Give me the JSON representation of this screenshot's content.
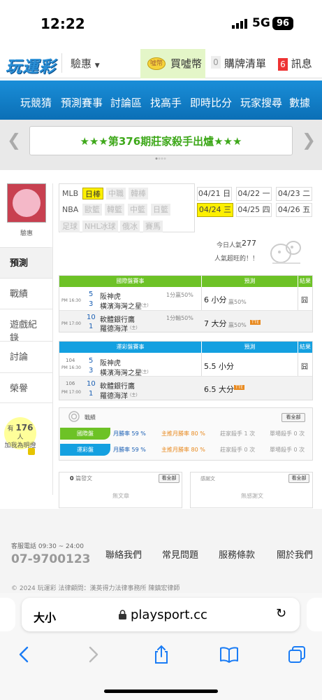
{
  "status": {
    "time": "12:22",
    "network": "5G",
    "battery": "96"
  },
  "header": {
    "logo": "玩運彩",
    "discount": "驗惠",
    "buy_coin": "買噓幣",
    "coin_icon_text": "噓幣",
    "cart_count": "0",
    "cart_label": "購牌清單",
    "msg_count": "6",
    "msg_label": "訊息"
  },
  "nav": {
    "items": [
      "玩競猜",
      "預測賽事",
      "討論區",
      "找高手",
      "即時比分",
      "玩家搜尋",
      "數據"
    ]
  },
  "banner": {
    "text": "★★★第376期莊家殺手出爐★★★"
  },
  "sidebar": {
    "username": "驗惠",
    "tabs": [
      "預測",
      "戰績",
      "遊戲紀錄",
      "討論",
      "榮譽"
    ],
    "followers": {
      "prefix": "有",
      "count": "176",
      "unit": "人",
      "suffix": "加我為明燈"
    }
  },
  "leagues": {
    "row1": [
      "MLB",
      "日棒",
      "中職",
      "韓棒"
    ],
    "row2": [
      "NBA",
      "歐籃",
      "韓籃",
      "中籃",
      "日籃"
    ],
    "row3": [
      "足球",
      "NHL冰球",
      "俄冰",
      "賽馬"
    ]
  },
  "dates": [
    "04/21 日",
    "04/22 一",
    "04/23 二",
    "04/24 三",
    "04/25 四",
    "04/26 五"
  ],
  "popularity": {
    "label": "今日人氣",
    "value": "277",
    "note": "人氣超旺的！！"
  },
  "intl_table": {
    "title": "國際盤賽事",
    "pred_col": "預測",
    "result_col": "結果",
    "rows": [
      {
        "time": "PM 16:30",
        "num1": "5",
        "team1": "阪神虎",
        "num2": "3",
        "team2": "橫濱海灣之星",
        "home": "(主)",
        "handicap": "1分贏50%",
        "pick": "6 小分",
        "pick_rate": "贏50%",
        "result": "囧"
      },
      {
        "time": "PM 17:00",
        "num1": "10",
        "team1": "軟體銀行鷹",
        "num2": "1",
        "team2": "羅德海洋",
        "home": "(主)",
        "handicap": "1分輸50%",
        "pick": "7 大分",
        "pick_rate": "贏50%",
        "tag": "TTE",
        "result": ""
      }
    ]
  },
  "lottery_table": {
    "title": "運彩盤賽事",
    "pred_col": "預測",
    "result_col": "結果",
    "rows": [
      {
        "no": "104",
        "time": "PM 16:30",
        "num1": "5",
        "team1": "阪神虎",
        "num2": "3",
        "team2": "橫濱海灣之星",
        "home": "(主)",
        "pick": "5.5 小分",
        "result": "囧"
      },
      {
        "no": "106",
        "time": "PM 17:00",
        "num1": "10",
        "team1": "軟體銀行鷹",
        "num2": "1",
        "team2": "羅德海洋",
        "home": "(主)",
        "pick": "6.5 大分",
        "tag": "TTE",
        "result": ""
      }
    ]
  },
  "records": {
    "title": "戰績",
    "see_all": "看全部",
    "intl": {
      "label": "國際盤",
      "month_rate": "月勝率 59 %",
      "main_rate": "主推月勝率 80 %",
      "killer": "莊家殺手 1 次",
      "single": "單場殺手 0 次"
    },
    "lottery": {
      "label": "運彩盤",
      "month_rate": "月勝率 59 %",
      "main_rate": "主推月勝率 80 %",
      "killer": "莊家殺手 0 次",
      "single": "單場殺手 0 次"
    }
  },
  "posts": {
    "left": {
      "count": "0",
      "title": "篇發文",
      "see_all": "看全部",
      "empty": "無文章"
    },
    "right": {
      "title": "感謝文",
      "see_all": "看全部",
      "empty": "無感謝文"
    }
  },
  "footer": {
    "service_label": "客服電話 09:30 ~ 24:00",
    "phone": "07-9700123",
    "links": [
      "聯絡我們",
      "常見問題",
      "服務條款",
      "關於我們"
    ],
    "copyright": "© 2024 玩運彩 法律顧問：漢英得力法律事務所 陳鎮宏律師"
  },
  "browser": {
    "text_size": "大小",
    "url": "playsport.cc"
  },
  "colors": {
    "nav_blue": "#0b6fb6",
    "green": "#6dc226",
    "cyan": "#14a0e0",
    "yellow": "#fdf000",
    "orange": "#e8891e"
  }
}
